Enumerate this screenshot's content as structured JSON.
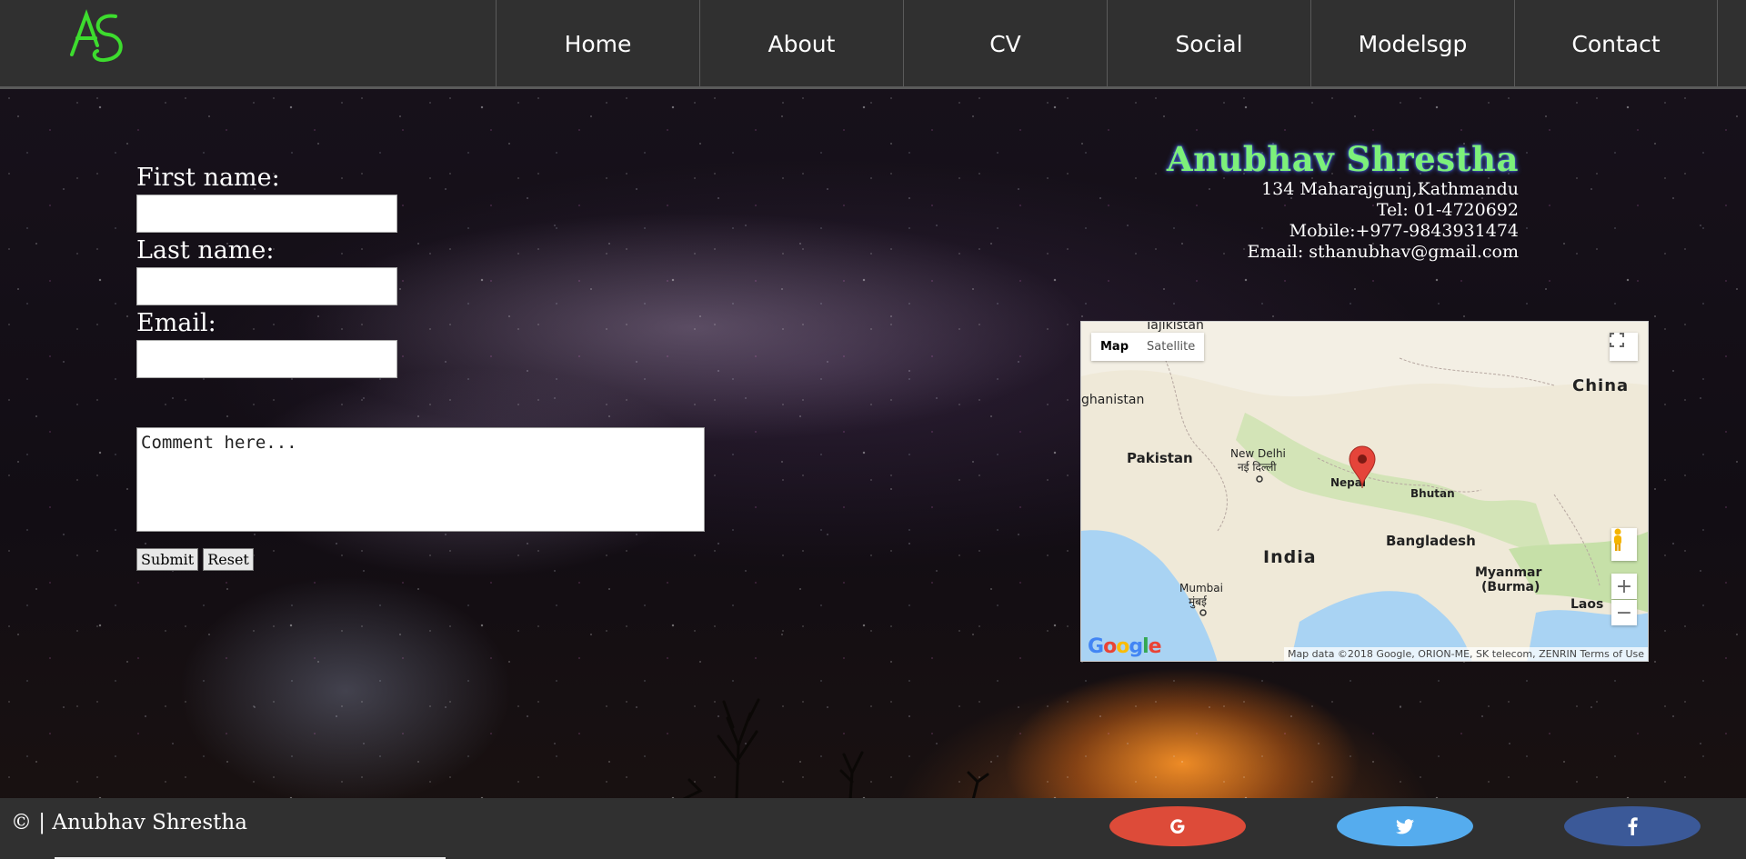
{
  "header": {
    "logo_text": "AS",
    "nav": [
      {
        "label": "Home"
      },
      {
        "label": "About"
      },
      {
        "label": "CV"
      },
      {
        "label": "Social"
      },
      {
        "label": "Modelsgp"
      },
      {
        "label": "Contact"
      }
    ]
  },
  "form": {
    "first_name_label": "First name:",
    "last_name_label": "Last name:",
    "email_label": "Email:",
    "first_name_value": "",
    "last_name_value": "",
    "email_value": "",
    "comment_placeholder": "Comment here...",
    "submit_label": "Submit",
    "reset_label": "Reset"
  },
  "contact": {
    "name": "Anubhav Shrestha",
    "address": "134 Maharajgunj,Kathmandu",
    "tel": "Tel: 01-4720692",
    "mobile": "Mobile:+977-9843931474",
    "email": "Email: sthanubhav@gmail.com"
  },
  "map": {
    "type_map": "Map",
    "type_satellite": "Satellite",
    "labels": {
      "tajikistan": "Tajikistan",
      "afghanistan": "ghanistan",
      "china": "China",
      "pakistan": "Pakistan",
      "new_delhi": "New Delhi",
      "new_delhi_local": "नई दिल्ली",
      "nepal": "Nepal",
      "bhutan": "Bhutan",
      "india": "India",
      "bangladesh": "Bangladesh",
      "mumbai": "Mumbai",
      "mumbai_local": "मुंबई",
      "myanmar": "Myanmar",
      "burma": "(Burma)",
      "laos": "Laos"
    },
    "google_logo": "Google",
    "attribution": "Map data ©2018 Google, ORION-ME, SK telecom, ZENRIN   Terms of Use",
    "zoom_in": "+",
    "zoom_out": "−"
  },
  "footer": {
    "copyright": "© | Anubhav Shrestha",
    "social": [
      {
        "name": "google",
        "icon": "G",
        "color": "#dd4b39"
      },
      {
        "name": "twitter",
        "icon": "twitter-bird",
        "color": "#55acee"
      },
      {
        "name": "facebook",
        "icon": "f",
        "color": "#3b5998"
      }
    ]
  },
  "colors": {
    "header_bg": "#303030",
    "name_green": "#7df07a",
    "logo_green": "#3ddc2e"
  }
}
